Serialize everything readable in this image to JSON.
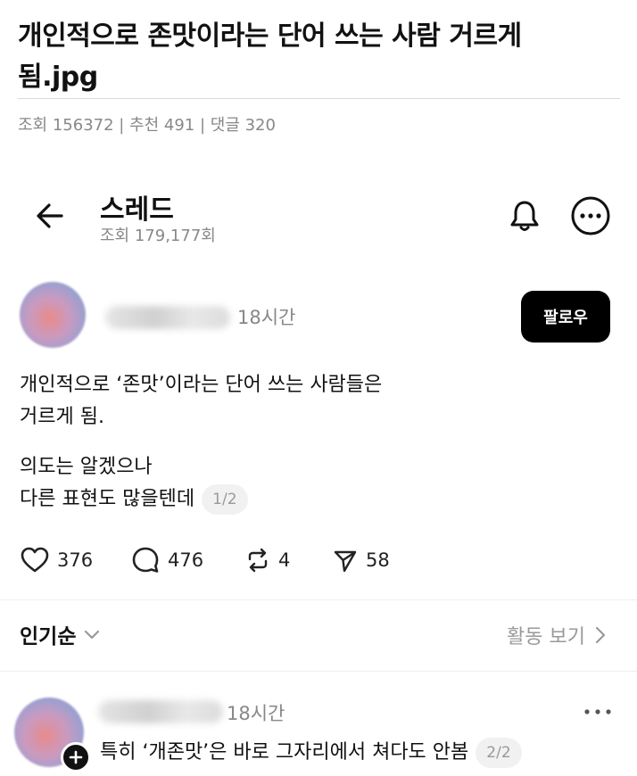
{
  "post": {
    "title": "개인적으로 존맛이라는 단어 쓰는 사람 거르게 됨.jpg",
    "meta": "조회 156372 | 추천 491 | 댓글 320"
  },
  "thread": {
    "title": "스레드",
    "views": "조회 179,177회"
  },
  "main_post": {
    "time": "18시간",
    "follow_label": "팔로우",
    "paragraph1_line1": "개인적으로 ‘존맛’이라는 단어 쓰는 사람들은",
    "paragraph1_line2": "거르게 됨.",
    "paragraph2_line1": "의도는 알겠으나",
    "paragraph2_line2": "다른 표현도 많을텐데",
    "page_badge": "1/2",
    "likes": "376",
    "replies": "476",
    "reposts": "4",
    "shares": "58"
  },
  "sort": {
    "label": "인기순",
    "activity_label": "활동 보기"
  },
  "reply": {
    "time": "18시간",
    "text": "특히 ‘개존맛’은 바로 그자리에서 쳐다도 안봄",
    "page_badge": "2/2"
  },
  "icons": {
    "back": "arrow-left-icon",
    "bell": "bell-icon",
    "more": "more-horizontal-circle-icon",
    "like": "heart-icon",
    "reply": "comment-icon",
    "repost": "repost-icon",
    "share": "send-icon",
    "sort": "chevron-down-icon",
    "activity": "chevron-right-icon",
    "add": "plus-icon",
    "reply_more": "more-horizontal-icon"
  }
}
